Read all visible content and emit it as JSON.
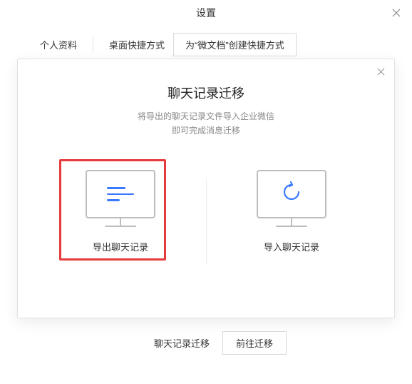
{
  "window": {
    "title": "设置"
  },
  "tabs": {
    "profile": "个人资料",
    "desktop_shortcut": "桌面快捷方式",
    "create_doc_shortcut": "为“微文档”创建快捷方式"
  },
  "modal": {
    "title": "聊天记录迁移",
    "sub_line1": "将导出的聊天记录文件导入企业微信",
    "sub_line2": "即可完成消息迁移",
    "option_export": "导出聊天记录",
    "option_import": "导入聊天记录"
  },
  "bottom": {
    "label": "聊天记录迁移",
    "button": "前往迁移"
  }
}
